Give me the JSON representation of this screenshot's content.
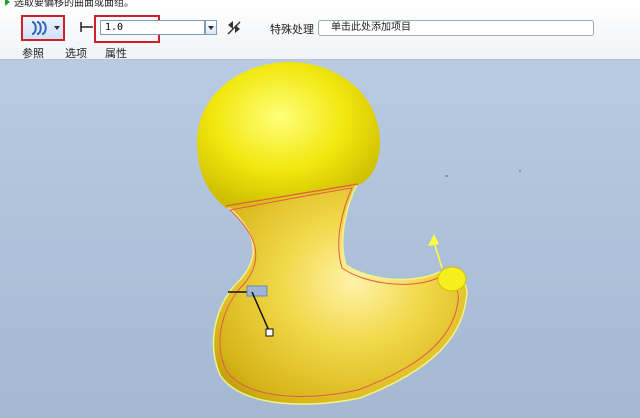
{
  "prompt": {
    "text": "选取要偏移的曲面或面组。"
  },
  "dashboard": {
    "offset_value": "1.0",
    "special_handling_label": "特殊处理",
    "add_item_text": "单击此处添加项目",
    "tabs": [
      "参照",
      "选项",
      "属性"
    ]
  },
  "colors": {
    "highlight": "#d01f2b",
    "model": "#f2e10a",
    "viewport_top": "#b9cbe2",
    "viewport_bottom": "#a4b8d2"
  },
  "icons": [
    "offset-type-icon",
    "dropdown-caret-icon",
    "offset-distance-icon",
    "flip-direction-icon",
    "drag-handle-icon",
    "direction-arrow-icon"
  ]
}
